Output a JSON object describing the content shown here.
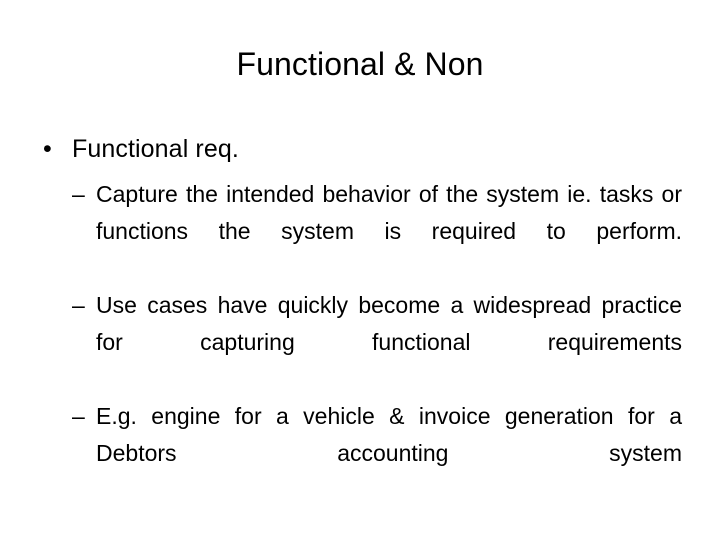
{
  "slide": {
    "title": "Functional & Non",
    "background_color": "#ffffff",
    "text_color": "#000000",
    "bullets": [
      {
        "level": 1,
        "marker": "•",
        "text": "Functional req."
      },
      {
        "level": 2,
        "marker": "–",
        "text": "Capture the intended behavior of the system ie. tasks or functions the system is required to perform."
      },
      {
        "level": 2,
        "marker": "–",
        "text": "Use cases have quickly become a widespread practice for capturing functional requirements"
      },
      {
        "level": 2,
        "marker": "–",
        "text": "E.g. engine for a vehicle & invoice generation for a Debtors accounting system"
      }
    ]
  }
}
